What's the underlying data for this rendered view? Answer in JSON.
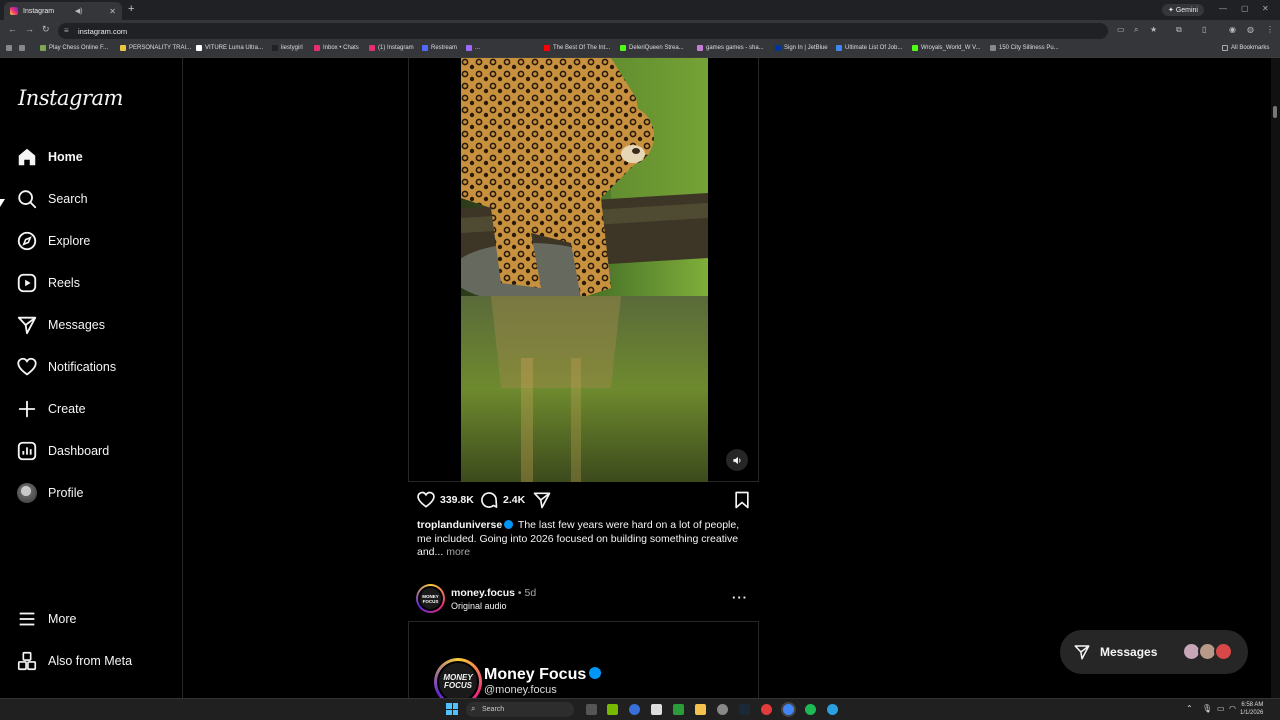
{
  "browser": {
    "tab_title": "Instagram",
    "url": "instagram.com",
    "gemini_label": "Gemini",
    "all_bookmarks": "All Bookmarks",
    "bookmarks": [
      {
        "label": "Play Chess Online F...",
        "color": "#7fa650"
      },
      {
        "label": "PERSONALITY TRAI...",
        "color": "#e8c547"
      },
      {
        "label": "VITURE Luma Ultra...",
        "color": "#ffffff"
      },
      {
        "label": "liestygirl",
        "color": "#222222"
      },
      {
        "label": "Inbox • Chats",
        "color": "#e1306c"
      },
      {
        "label": "(1) Instagram",
        "color": "#e1306c"
      },
      {
        "label": "Restream",
        "color": "#4f6bff"
      },
      {
        "label": "...",
        "color": "#9b6bff"
      },
      {
        "label": "The Best Of The Int...",
        "color": "#ff0000"
      },
      {
        "label": "DeleriQueen Strea...",
        "color": "#53fc18"
      },
      {
        "label": "games games - sha...",
        "color": "#c47bd8"
      },
      {
        "label": "Sign In | JetBlue",
        "color": "#0033a0"
      },
      {
        "label": "Ultimate List Of Job...",
        "color": "#4285f4"
      },
      {
        "label": "Wroyals_World_W V...",
        "color": "#53fc18"
      },
      {
        "label": "150 City Silliness Pu...",
        "color": "#888888"
      }
    ]
  },
  "sidebar": {
    "logo": "Instagram",
    "items": [
      {
        "label": "Home",
        "icon": "home-icon"
      },
      {
        "label": "Search",
        "icon": "search-icon"
      },
      {
        "label": "Explore",
        "icon": "compass-icon"
      },
      {
        "label": "Reels",
        "icon": "reels-icon"
      },
      {
        "label": "Messages",
        "icon": "paper-plane-icon"
      },
      {
        "label": "Notifications",
        "icon": "heart-icon"
      },
      {
        "label": "Create",
        "icon": "plus-icon"
      },
      {
        "label": "Dashboard",
        "icon": "dashboard-icon"
      },
      {
        "label": "Profile",
        "icon": "avatar"
      }
    ],
    "more": "More",
    "also_from_meta": "Also from Meta"
  },
  "post1": {
    "likes": "339.8K",
    "comments": "2.4K",
    "username": "troplanduniverse",
    "caption": "The last few years were hard on a lot of people, me included. Going into 2026 focused on building something creative and...",
    "more": "more"
  },
  "post2": {
    "username": "money.focus",
    "time": "• 5d",
    "audio": "Original audio",
    "avatar_text": "MONEY FOCUS",
    "card_avatar_text": "MONEY FOCUS",
    "card_name": "Money Focus",
    "card_handle": "@money.focus"
  },
  "messages_pill": {
    "label": "Messages",
    "avatar_colors": [
      "#c7a6b8",
      "#b89a8a",
      "#d94848"
    ]
  },
  "taskbar": {
    "search_placeholder": "Search",
    "time": "6:58 AM",
    "date": "1/1/2026"
  },
  "colors": {
    "background": "#000000",
    "text": "#f5f5f5",
    "secondary_text": "#a8a8a8",
    "verified": "#0095f6",
    "divider": "#262626"
  }
}
